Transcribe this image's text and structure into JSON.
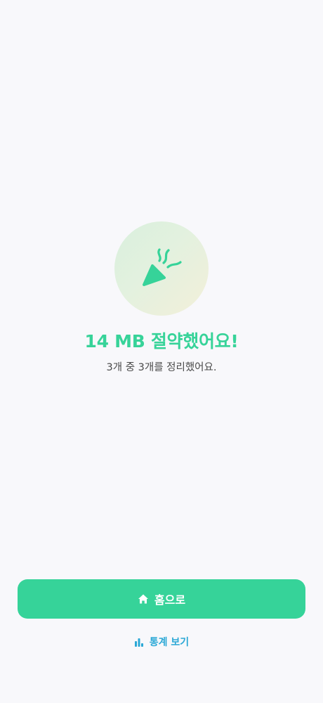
{
  "result": {
    "icon": "party-popper-icon",
    "title": "14 MB 절약했어요!",
    "subtitle": "3개 중 3개를 정리했어요."
  },
  "actions": {
    "home_button": {
      "icon": "home-icon",
      "label": "홈으로"
    },
    "stats_link": {
      "icon": "bar-chart-icon",
      "label": "통계 보기"
    }
  },
  "colors": {
    "background": "#f8f8fb",
    "accent": "#36d399",
    "link": "#2ba8d6",
    "text_secondary": "#4a4a4a"
  }
}
